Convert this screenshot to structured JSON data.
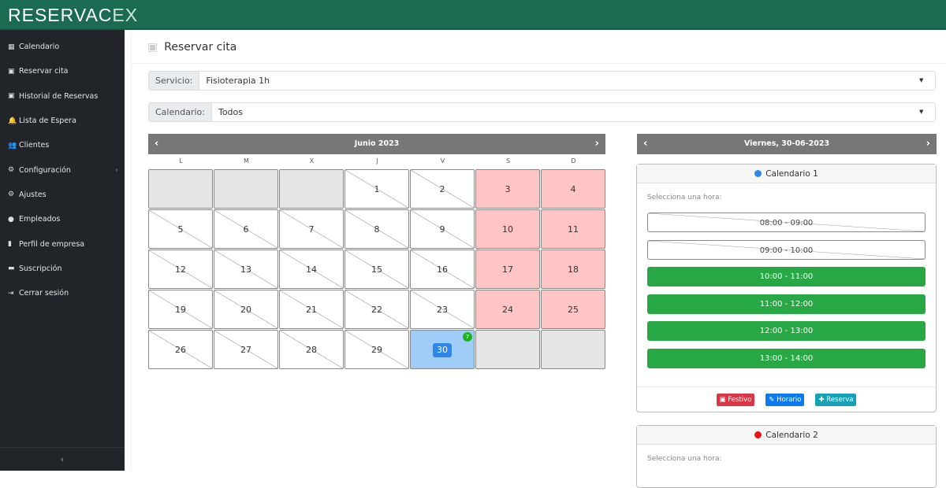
{
  "brand": {
    "main": "RESERVAC",
    "accent": "EX"
  },
  "sidebar": {
    "items": [
      {
        "label": "Calendario",
        "icon": "calendar-icon",
        "glyph": "▦"
      },
      {
        "label": "Reservar cita",
        "icon": "calendar-plus-icon",
        "glyph": "▣"
      },
      {
        "label": "Historial de Reservas",
        "icon": "calendar-check-icon",
        "glyph": "▣"
      },
      {
        "label": "Lista de Espera",
        "icon": "bell-icon",
        "glyph": "🔔"
      },
      {
        "label": "Clientes",
        "icon": "users-icon",
        "glyph": "👥"
      },
      {
        "label": "Configuración",
        "icon": "gear-icon",
        "glyph": "⚙",
        "chevron": "›"
      },
      {
        "label": "Ajustes",
        "icon": "gears-icon",
        "glyph": "⚙"
      },
      {
        "label": "Empleados",
        "icon": "user-circle-icon",
        "glyph": "●"
      },
      {
        "label": "Perfil de empresa",
        "icon": "building-icon",
        "glyph": "▮"
      },
      {
        "label": "Suscripción",
        "icon": "credit-card-icon",
        "glyph": "▬"
      },
      {
        "label": "Cerrar sesión",
        "icon": "sign-out-icon",
        "glyph": "⇥"
      }
    ],
    "collapse": "‹"
  },
  "page": {
    "title": "Reservar cita"
  },
  "filters": {
    "service_label": "Servicio:",
    "service_value": "Fisioterapia 1h",
    "calendar_label": "Calendario:",
    "calendar_value": "Todos"
  },
  "calendar": {
    "month": "Junio 2023",
    "weekdays": [
      "L",
      "M",
      "X",
      "J",
      "V",
      "S",
      "D"
    ],
    "cells": [
      {
        "t": "empty"
      },
      {
        "t": "empty"
      },
      {
        "t": "empty"
      },
      {
        "d": "1",
        "t": "past"
      },
      {
        "d": "2",
        "t": "past"
      },
      {
        "d": "3",
        "t": "wk"
      },
      {
        "d": "4",
        "t": "wk"
      },
      {
        "d": "5",
        "t": "past"
      },
      {
        "d": "6",
        "t": "past"
      },
      {
        "d": "7",
        "t": "past"
      },
      {
        "d": "8",
        "t": "past"
      },
      {
        "d": "9",
        "t": "past"
      },
      {
        "d": "10",
        "t": "wk"
      },
      {
        "d": "11",
        "t": "wk"
      },
      {
        "d": "12",
        "t": "past"
      },
      {
        "d": "13",
        "t": "past"
      },
      {
        "d": "14",
        "t": "past"
      },
      {
        "d": "15",
        "t": "past"
      },
      {
        "d": "16",
        "t": "past"
      },
      {
        "d": "17",
        "t": "wk"
      },
      {
        "d": "18",
        "t": "wk"
      },
      {
        "d": "19",
        "t": "past"
      },
      {
        "d": "20",
        "t": "past"
      },
      {
        "d": "21",
        "t": "past"
      },
      {
        "d": "22",
        "t": "past"
      },
      {
        "d": "23",
        "t": "past"
      },
      {
        "d": "24",
        "t": "wk"
      },
      {
        "d": "25",
        "t": "wk"
      },
      {
        "d": "26",
        "t": "past"
      },
      {
        "d": "27",
        "t": "past"
      },
      {
        "d": "28",
        "t": "past"
      },
      {
        "d": "29",
        "t": "past"
      },
      {
        "d": "30",
        "t": "sel2",
        "badge": "7"
      },
      {
        "t": "empty"
      },
      {
        "t": "empty"
      }
    ]
  },
  "day": {
    "title": "Viernes, 30-06-2023",
    "calendars": [
      {
        "name": "Calendario 1",
        "color": "#2e86e6",
        "hint": "Selecciona una hora:",
        "slots": [
          {
            "label": "08:00 - 09:00",
            "available": false
          },
          {
            "label": "09:00 - 10:00",
            "available": false
          },
          {
            "label": "10:00 - 11:00",
            "available": true
          },
          {
            "label": "11:00 - 12:00",
            "available": true
          },
          {
            "label": "12:00 - 13:00",
            "available": true
          },
          {
            "label": "13:00 - 14:00",
            "available": true
          }
        ],
        "buttons": [
          {
            "label": "Festivo",
            "glyph": "▣ ",
            "color": "#dc3545"
          },
          {
            "label": "Horario",
            "glyph": "✎ ",
            "color": "#0d7bf0"
          },
          {
            "label": "Reserva",
            "glyph": "✚ ",
            "color": "#17a2b8"
          }
        ]
      },
      {
        "name": "Calendario 2",
        "color": "#ee1111",
        "hint": "Selecciona una hora:"
      }
    ]
  }
}
